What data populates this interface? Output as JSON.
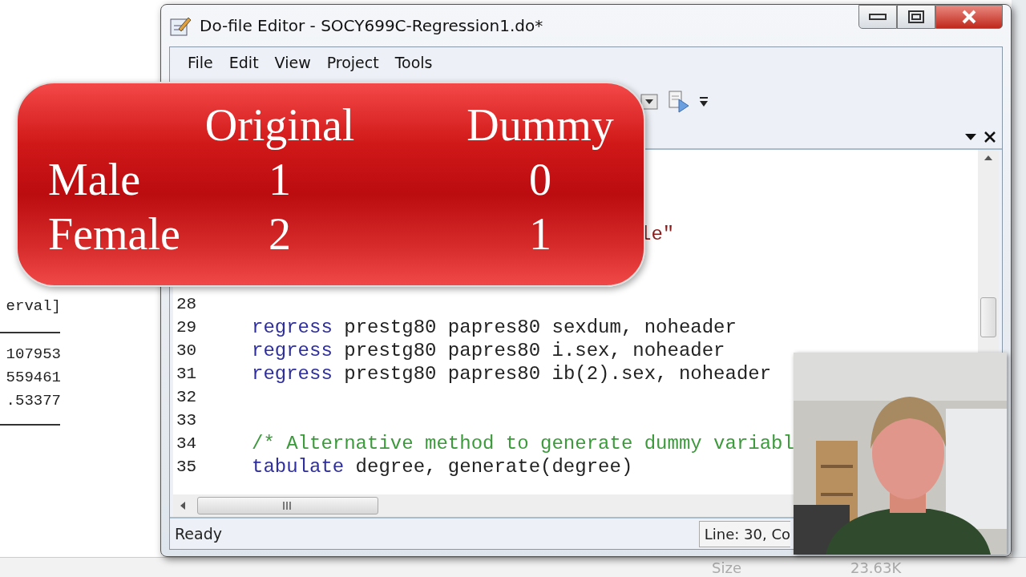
{
  "results_behind": {
    "lines": [
      "erval]",
      "107953",
      "559461",
      ".53377"
    ]
  },
  "window": {
    "title": "Do-file Editor - SOCY699C-Regression1.do*",
    "menu": [
      "File",
      "Edit",
      "View",
      "Project",
      "Tools"
    ],
    "editor": {
      "partial_line": {
        "segments": [
          {
            "kind": "string",
            "text": "le\""
          }
        ]
      },
      "lines": [
        {
          "number": "28"
        },
        {
          "number": "29",
          "segments": [
            {
              "kind": "keyword",
              "text": "regress"
            },
            {
              "kind": "plain",
              "text": " prestg80 papres80 sexdum, noheader"
            }
          ]
        },
        {
          "number": "30",
          "segments": [
            {
              "kind": "keyword",
              "text": "regress"
            },
            {
              "kind": "plain",
              "text": " prestg80 papres80 i.sex, noheader"
            }
          ]
        },
        {
          "number": "31",
          "segments": [
            {
              "kind": "keyword",
              "text": "regress"
            },
            {
              "kind": "plain",
              "text": " prestg80 papres80 ib(2).sex, noheader"
            }
          ]
        },
        {
          "number": "32"
        },
        {
          "number": "33"
        },
        {
          "number": "34",
          "segments": [
            {
              "kind": "comment",
              "text": "/* Alternative method to generate dummy variabl"
            }
          ]
        },
        {
          "number": "35",
          "segments": [
            {
              "kind": "keyword",
              "text": "tabulate"
            },
            {
              "kind": "plain",
              "text": " degree, generate(degree)"
            }
          ]
        }
      ]
    },
    "status_bar": {
      "message": "Ready",
      "position": "Line: 30, Co"
    }
  },
  "panel_behind": {
    "label": "Size",
    "value": "23.63K"
  },
  "overlay_table": {
    "columns": [
      "Original",
      "Dummy"
    ],
    "rows": [
      {
        "label": "Male",
        "original": "1",
        "dummy": "0"
      },
      {
        "label": "Female",
        "original": "2",
        "dummy": "1"
      }
    ]
  }
}
